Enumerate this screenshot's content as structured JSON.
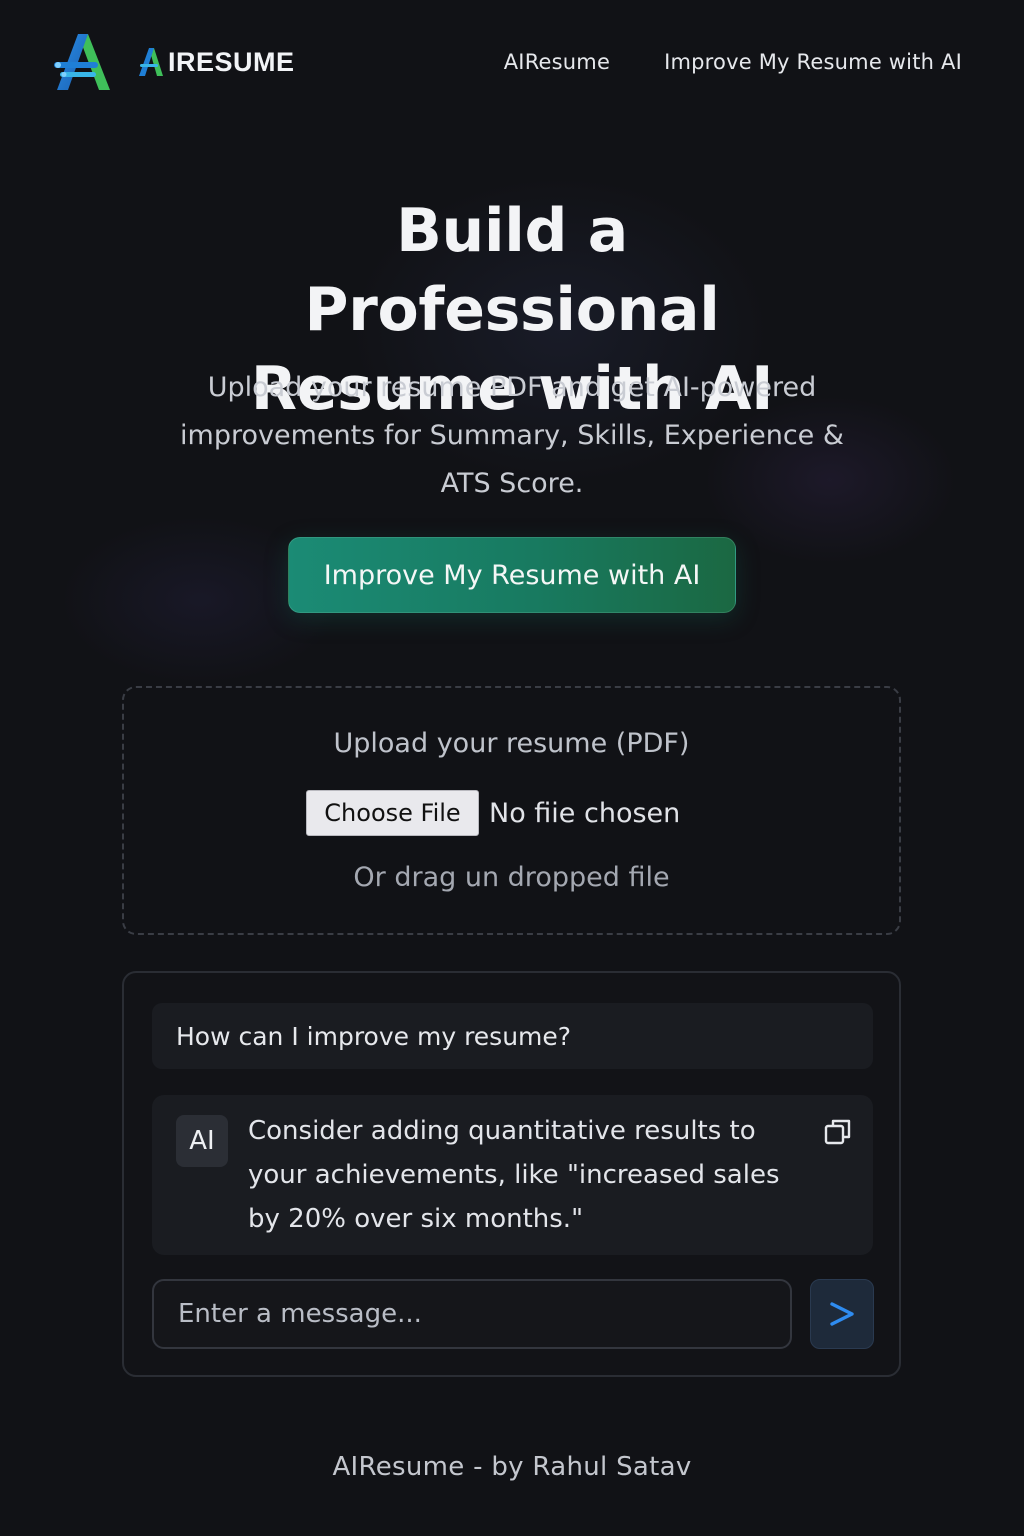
{
  "header": {
    "brand_prefix": "A",
    "brand_text": "IRESUME",
    "nav": [
      {
        "label": "AIResume"
      },
      {
        "label": "Improve My Resume with AI"
      }
    ]
  },
  "hero": {
    "title": "Build a Professional Resume with AI",
    "subtitle": "Upload your resume PDF and get AI-powered improvements for Summary, Skills, Experience & ATS Score.",
    "cta_label": "Improve My Resume with AI"
  },
  "upload": {
    "label": "Upload your resume (PDF)",
    "choose_label": "Choose File",
    "file_status": "No fiie chosen",
    "drag_text": "Or drag un dropped file"
  },
  "chat": {
    "user_message": "How can I improve my resume?",
    "ai_avatar": "AI",
    "ai_message": "Consider adding quantitative results to your achievements, like \"increased sales by 20% over six months.\"",
    "input_placeholder": "Enter a message..."
  },
  "footer": {
    "text": "AIResume - by Rahul Satav"
  },
  "colors": {
    "background": "#111216",
    "cta_start": "#1b8b75",
    "cta_end": "#1b6842",
    "logo_blue": "#1f7fd6",
    "logo_green": "#3fbf5a",
    "send_arrow": "#2f8cf0"
  },
  "icons": {
    "logo": "aresume-logo-icon",
    "copy": "copy-icon",
    "send": "send-arrow-icon"
  }
}
